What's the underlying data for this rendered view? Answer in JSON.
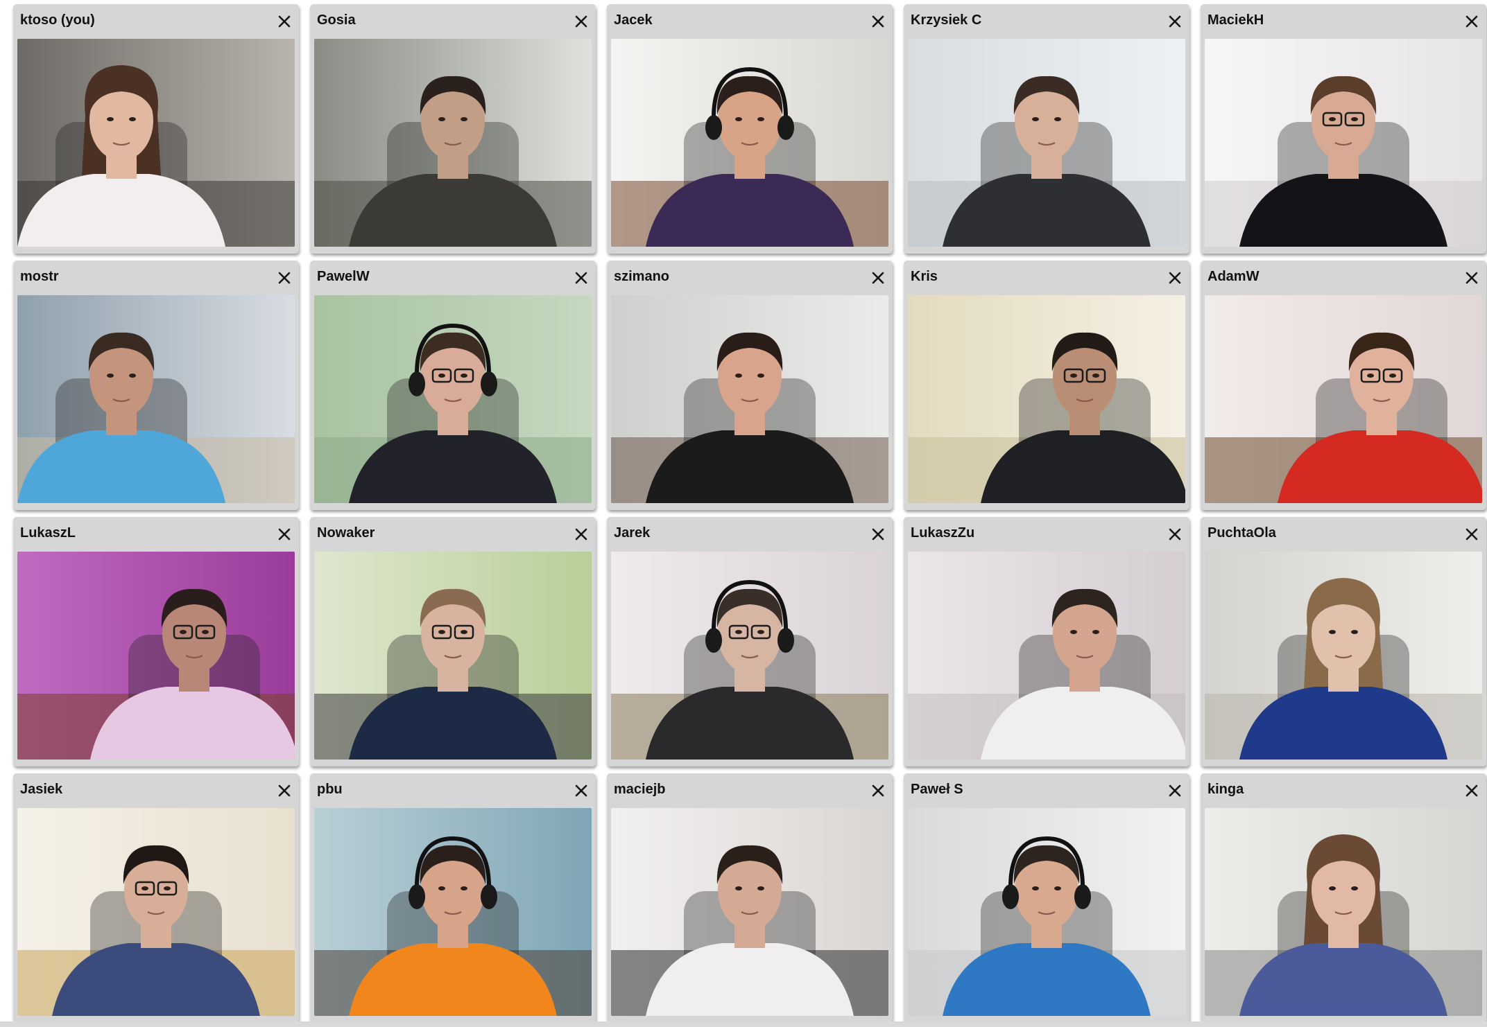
{
  "participants": [
    {
      "name": "ktoso (you)",
      "wall": "#6e6b66",
      "floor": "#3a3633",
      "light": "#b9b4ad",
      "light_side": "right",
      "shirt": "#f2eef0",
      "skin": "#e2b8a0",
      "hair": "#4a3124",
      "long_hair": true,
      "headphones": false,
      "glasses": false,
      "head_pos": "left"
    },
    {
      "name": "Gosia",
      "wall": "#8a8d84",
      "floor": "#4f5047",
      "light": "#dfe2dc",
      "light_side": "right",
      "shirt": "#3b3a36",
      "skin": "#c39e86",
      "hair": "#2a211c",
      "long_hair": false,
      "headphones": false,
      "glasses": false,
      "head_pos": "center"
    },
    {
      "name": "Jacek",
      "wall": "#d8d7d2",
      "floor": "#7a4a2f",
      "light": "#f4f4f2",
      "light_side": "left",
      "shirt": "#3b2a55",
      "skin": "#d8a488",
      "hair": "#2b1f1a",
      "long_hair": false,
      "headphones": true,
      "glasses": false,
      "head_pos": "center"
    },
    {
      "name": "Krzysiek C",
      "wall": "#d9dde0",
      "floor": "#b8bec2",
      "light": "#eef1f3",
      "light_side": "right",
      "shirt": "#2d2f33",
      "skin": "#d8b09a",
      "hair": "#3a2c24",
      "long_hair": false,
      "headphones": false,
      "glasses": false,
      "head_pos": "center"
    },
    {
      "name": "MaciekH",
      "wall": "#e6e4e6",
      "floor": "#cfcbcd",
      "light": "#f7f6f7",
      "light_side": "left",
      "shirt": "#141418",
      "skin": "#d8aa94",
      "hair": "#5b3d2c",
      "long_hair": false,
      "headphones": false,
      "glasses": true,
      "head_pos": "center"
    },
    {
      "name": "mostr",
      "wall": "#8fa0ad",
      "floor": "#c9b9a2",
      "light": "#d8dde2",
      "light_side": "right",
      "shirt": "#4ea7d8",
      "skin": "#c4957c",
      "hair": "#3a2b22",
      "long_hair": false,
      "headphones": false,
      "glasses": false,
      "head_pos": "left"
    },
    {
      "name": "PawelW",
      "wall": "#a9c3a2",
      "floor": "#8da988",
      "light": "#c5d8c0",
      "light_side": "right",
      "shirt": "#22222b",
      "skin": "#d8ac98",
      "hair": "#3c2c22",
      "long_hair": false,
      "headphones": true,
      "glasses": true,
      "head_pos": "center"
    },
    {
      "name": "szimano",
      "wall": "#cfcfcd",
      "floor": "#6c5a4a",
      "light": "#ebebea",
      "light_side": "right",
      "shirt": "#1b1b1b",
      "skin": "#d9a48c",
      "hair": "#2a1d17",
      "long_hair": false,
      "headphones": false,
      "glasses": false,
      "head_pos": "center"
    },
    {
      "name": "Kris",
      "wall": "#e3dbbf",
      "floor": "#c7bd98",
      "light": "#f4f0e4",
      "light_side": "right",
      "shirt": "#1f2024",
      "skin": "#b98e74",
      "hair": "#221a16",
      "long_hair": false,
      "headphones": false,
      "glasses": true,
      "head_pos": "right"
    },
    {
      "name": "AdamW",
      "wall": "#e2d7d6",
      "floor": "#6e4a2e",
      "light": "#f1ebea",
      "light_side": "left",
      "shirt": "#d42a22",
      "skin": "#e0b19b",
      "hair": "#3a2519",
      "long_hair": false,
      "headphones": false,
      "glasses": true,
      "head_pos": "right"
    },
    {
      "name": "LukaszL",
      "wall": "#9b3c9a",
      "floor": "#7a3f2a",
      "light": "#c06ac0",
      "light_side": "left",
      "shirt": "#e7c8e2",
      "skin": "#b98778",
      "hair": "#2a1e1c",
      "long_hair": false,
      "headphones": false,
      "glasses": true,
      "head_pos": "right"
    },
    {
      "name": "Nowaker",
      "wall": "#b8cf98",
      "floor": "#3a3a3c",
      "light": "#dfe6cf",
      "light_side": "left",
      "shirt": "#1d2a45",
      "skin": "#d8b4a0",
      "hair": "#8a6a50",
      "long_hair": false,
      "headphones": false,
      "glasses": true,
      "head_pos": "center"
    },
    {
      "name": "Jarek",
      "wall": "#dad3d7",
      "floor": "#8a7b5a",
      "light": "#efeaec",
      "light_side": "left",
      "shirt": "#2a2a2c",
      "skin": "#d7b5a3",
      "hair": "#3a2e28",
      "long_hair": false,
      "headphones": true,
      "glasses": true,
      "head_pos": "center"
    },
    {
      "name": "LukaszZu",
      "wall": "#d4cdd2",
      "floor": "#c3bcc0",
      "light": "#ebe6e9",
      "light_side": "left",
      "shirt": "#efefef",
      "skin": "#d4a58e",
      "hair": "#2d241f",
      "long_hair": false,
      "headphones": false,
      "glasses": false,
      "head_pos": "right"
    },
    {
      "name": "PuchtaOla",
      "wall": "#d4d3cf",
      "floor": "#b8b4ac",
      "light": "#eeeeeb",
      "light_side": "right",
      "shirt": "#1f3a8a",
      "skin": "#e1c1ac",
      "hair": "#8a6a48",
      "long_hair": true,
      "headphones": false,
      "glasses": false,
      "head_pos": "center"
    },
    {
      "name": "Jasiek",
      "wall": "#e8e0cf",
      "floor": "#c9a45a",
      "light": "#f5f1e8",
      "light_side": "left",
      "shirt": "#3b4c7c",
      "skin": "#d8ae98",
      "hair": "#1f1814",
      "long_hair": false,
      "headphones": false,
      "glasses": true,
      "head_pos": "center"
    },
    {
      "name": "pbu",
      "wall": "#7fa6b5",
      "floor": "#4a4038",
      "light": "#b9cfd6",
      "light_side": "left",
      "shirt": "#f0861c",
      "skin": "#d7a48a",
      "hair": "#2a1f1a",
      "long_hair": false,
      "headphones": true,
      "glasses": false,
      "head_pos": "center"
    },
    {
      "name": "maciejb",
      "wall": "#d9d5d3",
      "floor": "#2c2a2b",
      "light": "#f2f0ef",
      "light_side": "left",
      "shirt": "#f0eeee",
      "skin": "#d4aa94",
      "hair": "#2a1f19",
      "long_hair": false,
      "headphones": false,
      "glasses": false,
      "head_pos": "center"
    },
    {
      "name": "Paweł S",
      "wall": "#dadada",
      "floor": "#c4c6c8",
      "light": "#f2f2f2",
      "light_side": "right",
      "shirt": "#2f78c4",
      "skin": "#d9a98f",
      "hair": "#2d2420",
      "long_hair": false,
      "headphones": true,
      "glasses": false,
      "head_pos": "center"
    },
    {
      "name": "kinga",
      "wall": "#d6d6d2",
      "floor": "#8a8c8a",
      "light": "#ecece9",
      "light_side": "left",
      "shirt": "#4a5a9a",
      "skin": "#e2b9a4",
      "hair": "#6a4a34",
      "long_hair": true,
      "headphones": false,
      "glasses": false,
      "head_pos": "center"
    }
  ],
  "close_icon": "close-icon",
  "colors": {
    "tile_bg": "#d6d6d6",
    "title_text": "#111111",
    "page_bg": "#ffffff"
  }
}
